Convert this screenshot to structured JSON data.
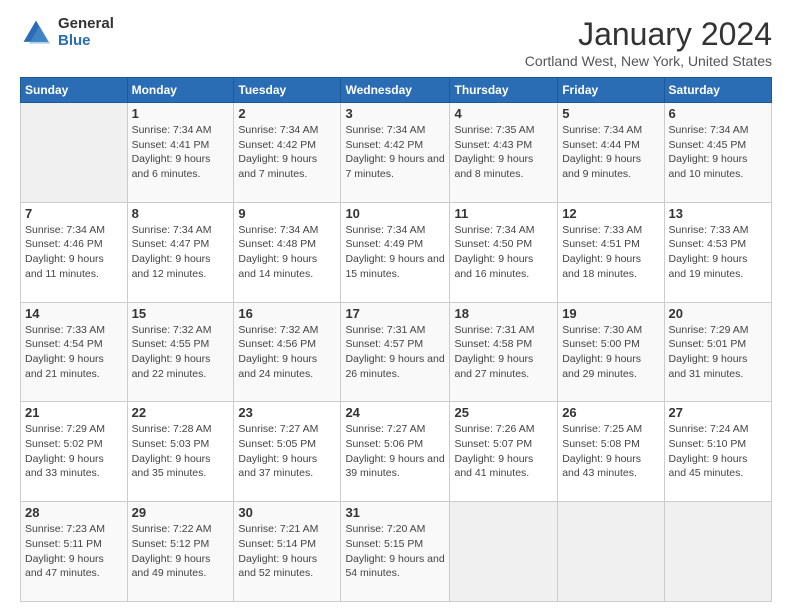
{
  "header": {
    "logo_general": "General",
    "logo_blue": "Blue",
    "title": "January 2024",
    "subtitle": "Cortland West, New York, United States"
  },
  "days_of_week": [
    "Sunday",
    "Monday",
    "Tuesday",
    "Wednesday",
    "Thursday",
    "Friday",
    "Saturday"
  ],
  "weeks": [
    [
      {
        "day": "",
        "empty": true
      },
      {
        "day": "1",
        "sunrise": "Sunrise: 7:34 AM",
        "sunset": "Sunset: 4:41 PM",
        "daylight": "Daylight: 9 hours and 6 minutes."
      },
      {
        "day": "2",
        "sunrise": "Sunrise: 7:34 AM",
        "sunset": "Sunset: 4:42 PM",
        "daylight": "Daylight: 9 hours and 7 minutes."
      },
      {
        "day": "3",
        "sunrise": "Sunrise: 7:34 AM",
        "sunset": "Sunset: 4:42 PM",
        "daylight": "Daylight: 9 hours and 7 minutes."
      },
      {
        "day": "4",
        "sunrise": "Sunrise: 7:35 AM",
        "sunset": "Sunset: 4:43 PM",
        "daylight": "Daylight: 9 hours and 8 minutes."
      },
      {
        "day": "5",
        "sunrise": "Sunrise: 7:34 AM",
        "sunset": "Sunset: 4:44 PM",
        "daylight": "Daylight: 9 hours and 9 minutes."
      },
      {
        "day": "6",
        "sunrise": "Sunrise: 7:34 AM",
        "sunset": "Sunset: 4:45 PM",
        "daylight": "Daylight: 9 hours and 10 minutes."
      }
    ],
    [
      {
        "day": "7",
        "sunrise": "Sunrise: 7:34 AM",
        "sunset": "Sunset: 4:46 PM",
        "daylight": "Daylight: 9 hours and 11 minutes."
      },
      {
        "day": "8",
        "sunrise": "Sunrise: 7:34 AM",
        "sunset": "Sunset: 4:47 PM",
        "daylight": "Daylight: 9 hours and 12 minutes."
      },
      {
        "day": "9",
        "sunrise": "Sunrise: 7:34 AM",
        "sunset": "Sunset: 4:48 PM",
        "daylight": "Daylight: 9 hours and 14 minutes."
      },
      {
        "day": "10",
        "sunrise": "Sunrise: 7:34 AM",
        "sunset": "Sunset: 4:49 PM",
        "daylight": "Daylight: 9 hours and 15 minutes."
      },
      {
        "day": "11",
        "sunrise": "Sunrise: 7:34 AM",
        "sunset": "Sunset: 4:50 PM",
        "daylight": "Daylight: 9 hours and 16 minutes."
      },
      {
        "day": "12",
        "sunrise": "Sunrise: 7:33 AM",
        "sunset": "Sunset: 4:51 PM",
        "daylight": "Daylight: 9 hours and 18 minutes."
      },
      {
        "day": "13",
        "sunrise": "Sunrise: 7:33 AM",
        "sunset": "Sunset: 4:53 PM",
        "daylight": "Daylight: 9 hours and 19 minutes."
      }
    ],
    [
      {
        "day": "14",
        "sunrise": "Sunrise: 7:33 AM",
        "sunset": "Sunset: 4:54 PM",
        "daylight": "Daylight: 9 hours and 21 minutes."
      },
      {
        "day": "15",
        "sunrise": "Sunrise: 7:32 AM",
        "sunset": "Sunset: 4:55 PM",
        "daylight": "Daylight: 9 hours and 22 minutes."
      },
      {
        "day": "16",
        "sunrise": "Sunrise: 7:32 AM",
        "sunset": "Sunset: 4:56 PM",
        "daylight": "Daylight: 9 hours and 24 minutes."
      },
      {
        "day": "17",
        "sunrise": "Sunrise: 7:31 AM",
        "sunset": "Sunset: 4:57 PM",
        "daylight": "Daylight: 9 hours and 26 minutes."
      },
      {
        "day": "18",
        "sunrise": "Sunrise: 7:31 AM",
        "sunset": "Sunset: 4:58 PM",
        "daylight": "Daylight: 9 hours and 27 minutes."
      },
      {
        "day": "19",
        "sunrise": "Sunrise: 7:30 AM",
        "sunset": "Sunset: 5:00 PM",
        "daylight": "Daylight: 9 hours and 29 minutes."
      },
      {
        "day": "20",
        "sunrise": "Sunrise: 7:29 AM",
        "sunset": "Sunset: 5:01 PM",
        "daylight": "Daylight: 9 hours and 31 minutes."
      }
    ],
    [
      {
        "day": "21",
        "sunrise": "Sunrise: 7:29 AM",
        "sunset": "Sunset: 5:02 PM",
        "daylight": "Daylight: 9 hours and 33 minutes."
      },
      {
        "day": "22",
        "sunrise": "Sunrise: 7:28 AM",
        "sunset": "Sunset: 5:03 PM",
        "daylight": "Daylight: 9 hours and 35 minutes."
      },
      {
        "day": "23",
        "sunrise": "Sunrise: 7:27 AM",
        "sunset": "Sunset: 5:05 PM",
        "daylight": "Daylight: 9 hours and 37 minutes."
      },
      {
        "day": "24",
        "sunrise": "Sunrise: 7:27 AM",
        "sunset": "Sunset: 5:06 PM",
        "daylight": "Daylight: 9 hours and 39 minutes."
      },
      {
        "day": "25",
        "sunrise": "Sunrise: 7:26 AM",
        "sunset": "Sunset: 5:07 PM",
        "daylight": "Daylight: 9 hours and 41 minutes."
      },
      {
        "day": "26",
        "sunrise": "Sunrise: 7:25 AM",
        "sunset": "Sunset: 5:08 PM",
        "daylight": "Daylight: 9 hours and 43 minutes."
      },
      {
        "day": "27",
        "sunrise": "Sunrise: 7:24 AM",
        "sunset": "Sunset: 5:10 PM",
        "daylight": "Daylight: 9 hours and 45 minutes."
      }
    ],
    [
      {
        "day": "28",
        "sunrise": "Sunrise: 7:23 AM",
        "sunset": "Sunset: 5:11 PM",
        "daylight": "Daylight: 9 hours and 47 minutes."
      },
      {
        "day": "29",
        "sunrise": "Sunrise: 7:22 AM",
        "sunset": "Sunset: 5:12 PM",
        "daylight": "Daylight: 9 hours and 49 minutes."
      },
      {
        "day": "30",
        "sunrise": "Sunrise: 7:21 AM",
        "sunset": "Sunset: 5:14 PM",
        "daylight": "Daylight: 9 hours and 52 minutes."
      },
      {
        "day": "31",
        "sunrise": "Sunrise: 7:20 AM",
        "sunset": "Sunset: 5:15 PM",
        "daylight": "Daylight: 9 hours and 54 minutes."
      },
      {
        "day": "",
        "empty": true
      },
      {
        "day": "",
        "empty": true
      },
      {
        "day": "",
        "empty": true
      }
    ]
  ]
}
